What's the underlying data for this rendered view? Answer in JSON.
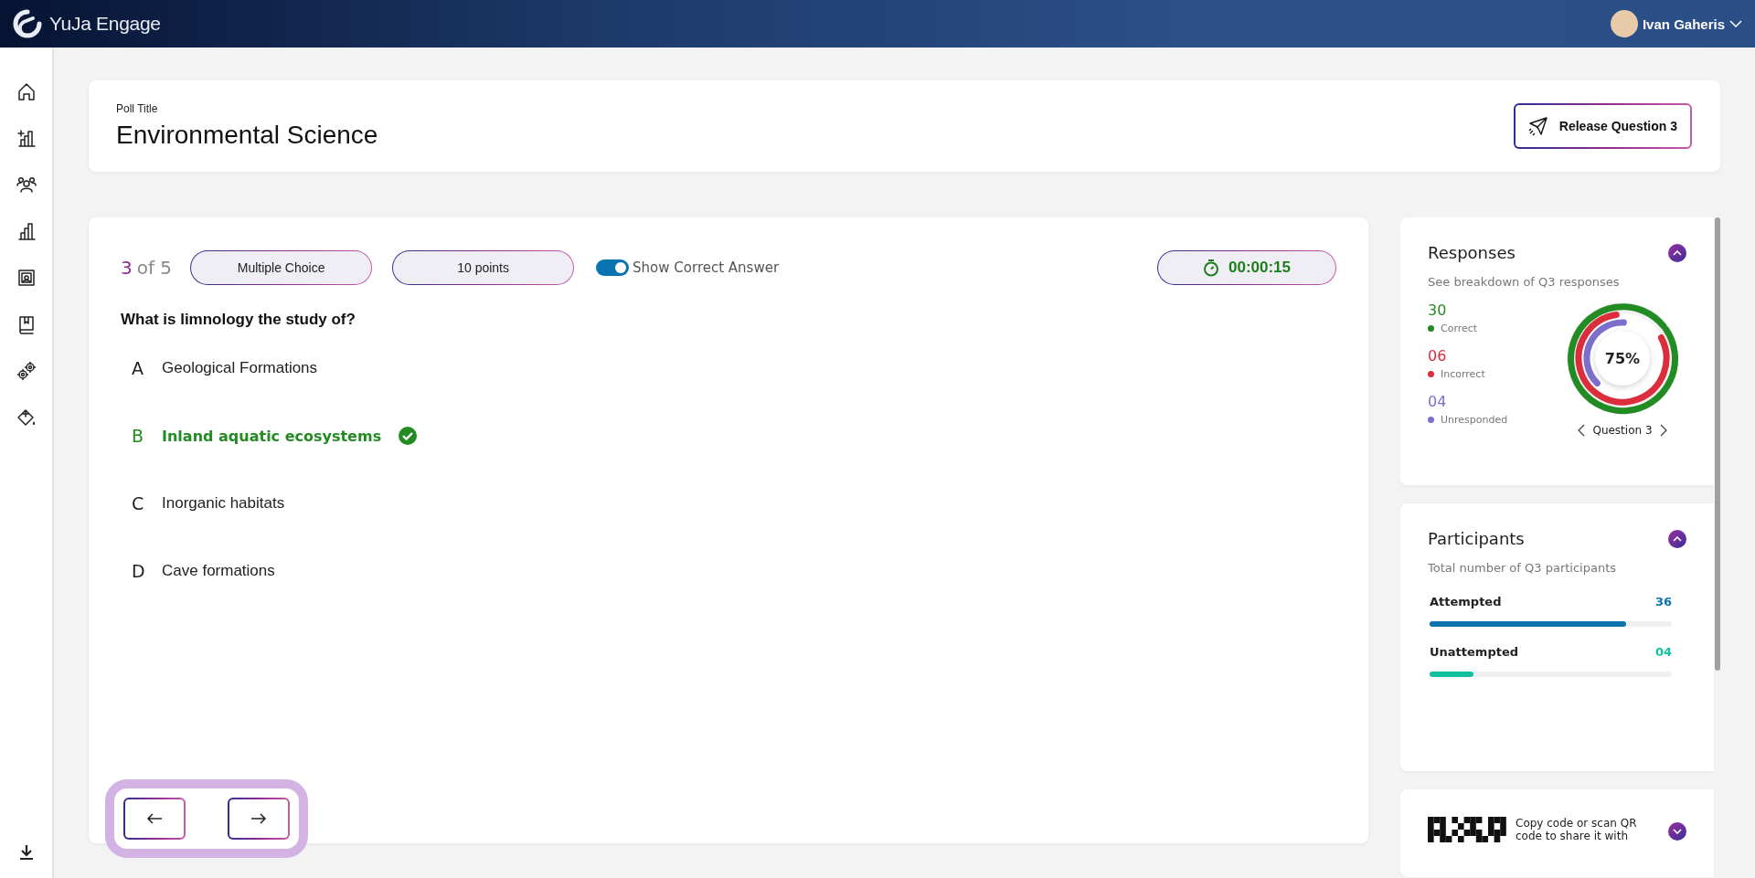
{
  "app": {
    "name": "YuJa Engage",
    "user": "Ivan Gaheris"
  },
  "poll": {
    "label": "Poll Title",
    "title": "Environmental Science",
    "release_button": "Release Question 3"
  },
  "question": {
    "current": "3",
    "total": "of 5",
    "type": "Multiple Choice",
    "points": "10 points",
    "show_correct": {
      "label": "Show Correct Answer",
      "on": true
    },
    "timer": "00:00:15",
    "text": "What is limnology the study of?",
    "answers": [
      {
        "letter": "A",
        "text": "Geological Formations",
        "correct": false
      },
      {
        "letter": "B",
        "text": "Inland aquatic ecosystems",
        "correct": true
      },
      {
        "letter": "C",
        "text": "Inorganic habitats",
        "correct": false
      },
      {
        "letter": "D",
        "text": "Cave formations",
        "correct": false
      }
    ]
  },
  "responses": {
    "title": "Responses",
    "subtitle": "See breakdown of Q3 responses",
    "stats": [
      {
        "value": "30",
        "label": "Correct",
        "color": "#228b22"
      },
      {
        "value": "06",
        "label": "Incorrect",
        "color": "#dc2d3c"
      },
      {
        "value": "04",
        "label": "Unresponded",
        "color": "#7b6fcb"
      }
    ],
    "center": "75%",
    "question_label": "Question 3"
  },
  "participants": {
    "title": "Participants",
    "subtitle": "Total number of Q3 participants",
    "bars": [
      {
        "label": "Attempted",
        "value": "36",
        "level": 0.81,
        "color": "#0a74b0"
      },
      {
        "label": "Unattempted",
        "value": "04",
        "level": 0.18,
        "color": "#12c0a0"
      }
    ]
  },
  "share": {
    "text": "Copy code or scan QR code to share it with"
  }
}
